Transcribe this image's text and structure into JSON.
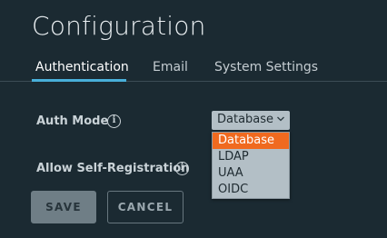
{
  "page": {
    "title": "Configuration"
  },
  "tabs": [
    {
      "label": "Authentication",
      "active": true
    },
    {
      "label": "Email",
      "active": false
    },
    {
      "label": "System Settings",
      "active": false
    }
  ],
  "form": {
    "auth_mode_label": "Auth Mode",
    "auth_mode_value": "Database",
    "auth_mode_options": [
      "Database",
      "LDAP",
      "UAA",
      "OIDC"
    ],
    "self_registration_label": "Allow Self-Registration",
    "info_glyph": "i"
  },
  "buttons": {
    "save_label": "SAVE",
    "cancel_label": "CANCEL"
  },
  "colors": {
    "background": "#1b2a32",
    "tab_accent": "#49afd9",
    "option_highlight": "#f06a1f",
    "select_bg": "#b3bfc6"
  },
  "icons": {
    "info": "info-icon",
    "dropdown": "chevron-down-icon"
  }
}
